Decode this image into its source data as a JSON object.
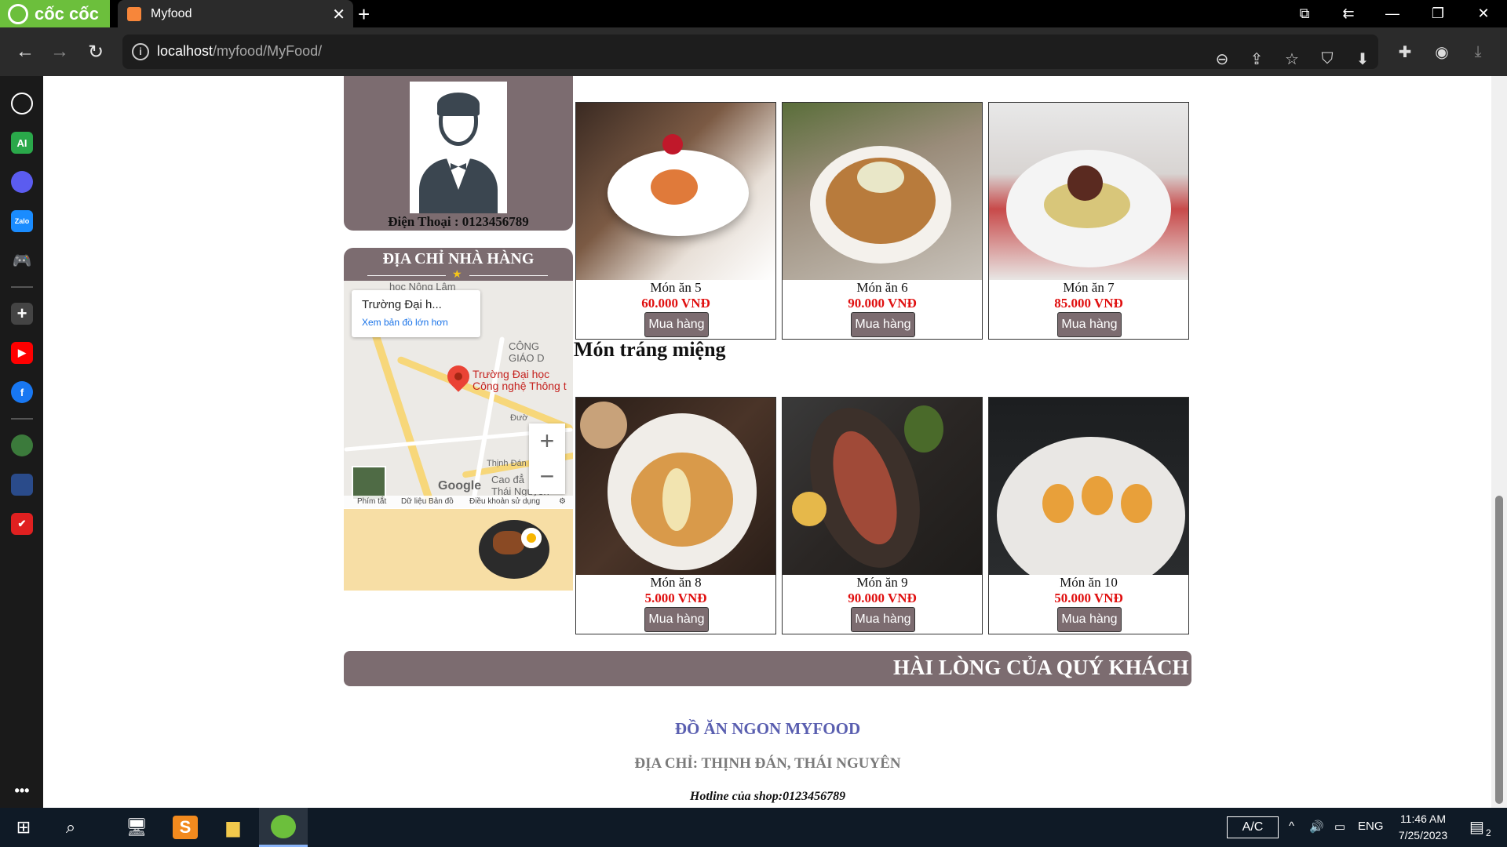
{
  "browser": {
    "brand": "cốc cốc",
    "tab_title": "Myfood",
    "url_host": "localhost",
    "url_path": "/myfood/MyFood/"
  },
  "contact": {
    "phone": "Điện Thoại : 0123456789"
  },
  "address_panel": {
    "title": "ĐỊA CHỈ NHÀ HÀNG",
    "map": {
      "card_title": "Trường Đại h...",
      "card_link": "Xem bản đồ lớn hơn",
      "pin_label_line1": "Trường Đại học",
      "pin_label_line2": "Công nghệ Thông t",
      "place_1": "học Nông Lâm",
      "place_2_line1": "CÔNG",
      "place_2_line2": "GIÁO D",
      "place_3": "Thịnh Đán",
      "place_4_line1": "Cao đẳ",
      "place_4_line2": "Thái Nguyen",
      "place_5": "Đườ",
      "google": "Google",
      "footer_shortcuts": "Phím tắt",
      "footer_data": "Dữ liệu Bản đồ",
      "footer_terms": "Điều khoản sử dụng",
      "zoom_in": "+",
      "zoom_out": "−"
    }
  },
  "sections": [
    {
      "title": "",
      "items": [
        {
          "name": "Món ăn 5",
          "price": "60.000 VNĐ",
          "button": "Mua hàng"
        },
        {
          "name": "Món ăn 6",
          "price": "90.000 VNĐ",
          "button": "Mua hàng"
        },
        {
          "name": "Món ăn 7",
          "price": "85.000 VNĐ",
          "button": "Mua hàng"
        }
      ]
    },
    {
      "title": "Món tráng miệng",
      "items": [
        {
          "name": "Món ăn 8",
          "price": "5.000 VNĐ",
          "button": "Mua hàng"
        },
        {
          "name": "Món ăn 9",
          "price": "90.000 VNĐ",
          "button": "Mua hàng"
        },
        {
          "name": "Món ăn 10",
          "price": "50.000 VNĐ",
          "button": "Mua hàng"
        }
      ]
    }
  ],
  "marquee": "HÀI LÒNG CỦA QUÝ KHÁCH L",
  "footer": {
    "brand": "ĐỒ ĂN NGON MYFOOD",
    "address": "ĐỊA CHỈ: THỊNH ĐÁN, THÁI NGUYÊN",
    "hotline": "Hotline của shop:0123456789"
  },
  "taskbar": {
    "ac": "A/C",
    "lang": "ENG",
    "time": "11:46 AM",
    "date": "7/25/2023",
    "notifications": "2"
  },
  "colors": {
    "panel": "#7c6c70",
    "price": "#e01010",
    "footer_brand": "#5a5fb0",
    "footer_address": "#7a7a7a"
  }
}
